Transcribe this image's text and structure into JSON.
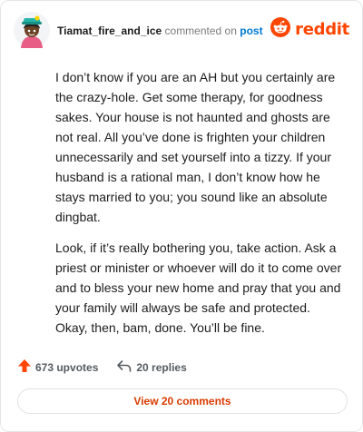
{
  "comment": {
    "username": "Tiamat_fire_and_ice",
    "action_text": "commented on",
    "post_link": "post",
    "paragraphs": [
      "I don’t know if you are an AH but you certainly are the crazy-hole. Get some therapy, for goodness sakes. Your house is not haunted and ghosts are not real. All you’ve done is frighten your children unnecessarily and set yourself into a tizzy. If your husband is a rational man, I don’t know how he stays married to you; you sound like an absolute dingbat.",
      "Look, if it’s really bothering you, take action. Ask a priest or minister or whoever will do it to come over and to bless your new home and pray that you and your family will always be safe and protected. Okay, then, bam, done. You’ll be fine."
    ]
  },
  "brand": {
    "name": "reddit",
    "color": "#ff4500",
    "icon": "reddit-logo-icon"
  },
  "stats": {
    "upvotes": "673 upvotes",
    "replies": "20 replies",
    "upvote_color": "#ff4500"
  },
  "actions": {
    "view_comments": "View 20 comments"
  }
}
